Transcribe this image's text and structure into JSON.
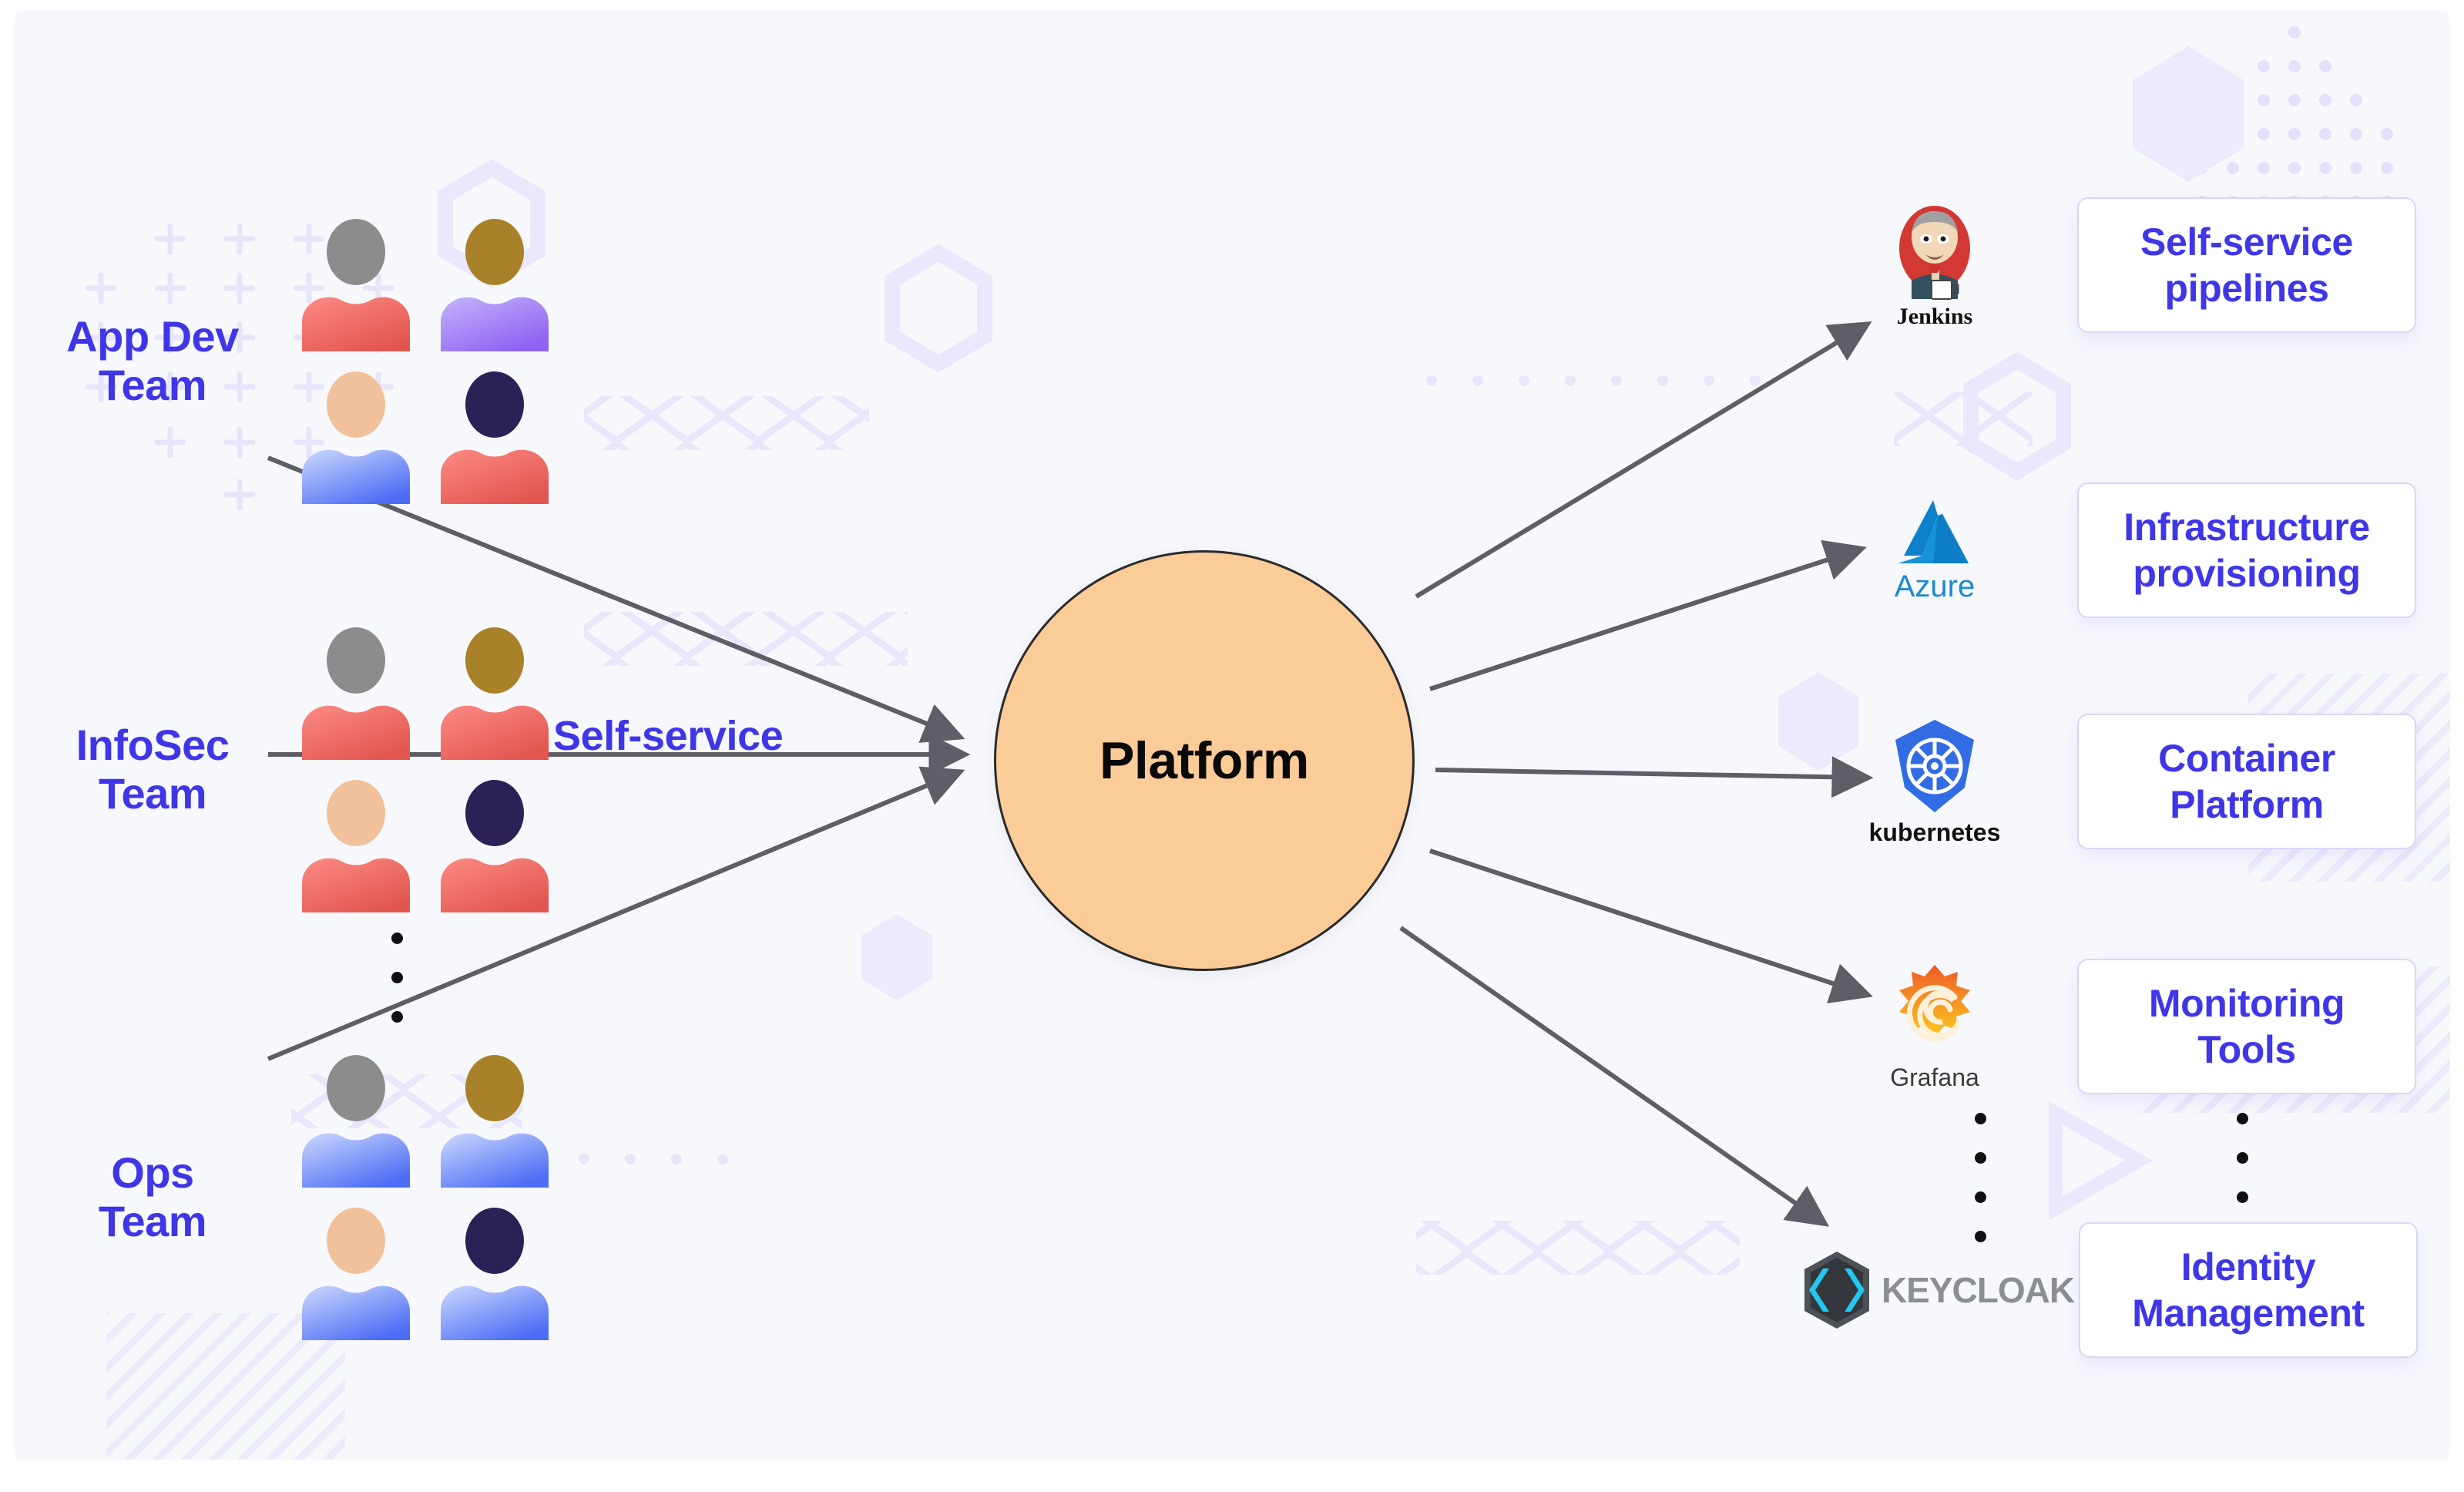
{
  "diagram": {
    "title_node": "Platform",
    "flow_label": "Self-service"
  },
  "consumers": [
    {
      "label": "App Dev\nTeam",
      "label_line1": "App Dev",
      "label_line2": "Team",
      "members": [
        {
          "head": "#8c8c8c",
          "body_top": "#fc8b84",
          "body_bottom": "#e2564f"
        },
        {
          "head": "#a98128",
          "body_top": "#c3b4fb",
          "body_bottom": "#8f62f2"
        },
        {
          "head": "#f0c19a",
          "body_top": "#cdd9fd",
          "body_bottom": "#4c6cf5"
        },
        {
          "head": "#2c2156",
          "body_top": "#fc8b84",
          "body_bottom": "#e2564f"
        }
      ]
    },
    {
      "label": "InfoSec\nTeam",
      "label_line1": "InfoSec",
      "label_line2": "Team",
      "members": [
        {
          "head": "#8c8c8c",
          "body_top": "#fc8b84",
          "body_bottom": "#e2564f"
        },
        {
          "head": "#a98128",
          "body_top": "#fc8b84",
          "body_bottom": "#e2564f"
        },
        {
          "head": "#f0c19a",
          "body_top": "#fc8b84",
          "body_bottom": "#e2564f"
        },
        {
          "head": "#2c2156",
          "body_top": "#fc8b84",
          "body_bottom": "#e2564f"
        }
      ]
    },
    {
      "label": "Ops\nTeam",
      "label_line1": "Ops",
      "label_line2": "Team",
      "members": [
        {
          "head": "#8c8c8c",
          "body_top": "#cdd9fd",
          "body_bottom": "#4c6cf5"
        },
        {
          "head": "#a98128",
          "body_top": "#cdd9fd",
          "body_bottom": "#4c6cf5"
        },
        {
          "head": "#f0c19a",
          "body_top": "#cdd9fd",
          "body_bottom": "#4c6cf5"
        },
        {
          "head": "#2c2156",
          "body_top": "#cdd9fd",
          "body_bottom": "#4c6cf5"
        }
      ]
    }
  ],
  "capabilities": [
    {
      "tool": "Jenkins",
      "tool_icon": "jenkins-logo-icon",
      "card_line1": "Self-service",
      "card_line2": "pipelines"
    },
    {
      "tool": "Azure",
      "tool_icon": "azure-logo-icon",
      "card_line1": "Infrastructure",
      "card_line2": "provisioning"
    },
    {
      "tool": "kubernetes",
      "tool_icon": "kubernetes-logo-icon",
      "card_line1": "Container",
      "card_line2": "Platform"
    },
    {
      "tool": "Grafana",
      "tool_icon": "grafana-logo-icon",
      "card_line1": "Monitoring",
      "card_line2": "Tools"
    },
    {
      "tool": "KEYCLOAK",
      "tool_icon": "keycloak-logo-icon",
      "card_line1": "Identity",
      "card_line2": "Management"
    }
  ],
  "colors": {
    "accent_indigo": "#3f36e8",
    "platform_fill": "#fbcb98",
    "platform_stroke": "#2b2b2b",
    "canvas_bg": "#f7f8fc",
    "card_border": "#d8d6f8",
    "arrow_gray": "#5e5e66",
    "deco_lavender": "#e8e7fb"
  }
}
